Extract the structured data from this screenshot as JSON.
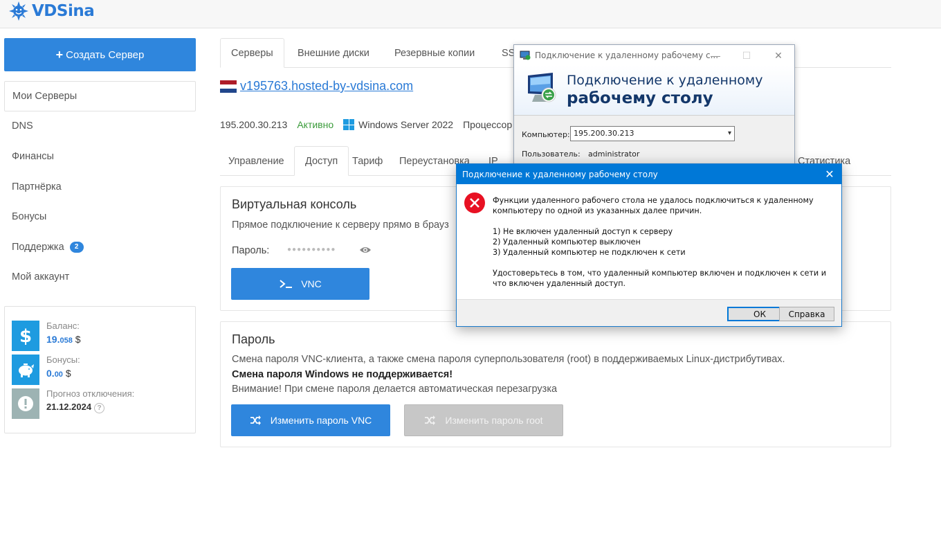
{
  "brand": {
    "logo_text": "VDSina"
  },
  "sidebar": {
    "create_label": "Создать Сервер",
    "items": [
      {
        "label": "Мои Серверы"
      },
      {
        "label": "DNS"
      },
      {
        "label": "Финансы"
      },
      {
        "label": "Партнёрка"
      },
      {
        "label": "Бонусы"
      },
      {
        "label": "Поддержка",
        "badge": "2"
      },
      {
        "label": "Мой аккаунт"
      }
    ],
    "balance": {
      "label": "Баланс:",
      "int": "19.",
      "dec": "058",
      "currency": "$"
    },
    "bonuses": {
      "label": "Бонусы:",
      "int": "0.",
      "dec": "00",
      "currency": "$"
    },
    "forecast": {
      "label": "Прогноз отключения:",
      "value": "21.12.2024",
      "help": "?"
    }
  },
  "main": {
    "tabs": [
      "Серверы",
      "Внешние диски",
      "Резервные копии",
      "SS"
    ],
    "host": "v195763.hosted-by-vdsina.com",
    "ip": "195.200.30.213",
    "status": "Активно",
    "os": "Windows Server 2022",
    "cpu_label": "Процессор",
    "sub_tabs": [
      "Управление",
      "Доступ",
      "Тариф",
      "Переустановка",
      "IP",
      "Статистика"
    ],
    "console": {
      "title": "Виртуальная консоль",
      "desc": "Прямое подключение к серверу прямо в брауз",
      "password_label": "Пароль:",
      "password_mask": "●●●●●●●●●●",
      "vnc_label": "VNC"
    },
    "password_panel": {
      "title": "Пароль",
      "line1": "Смена пароля VNC-клиента, а также смена пароля суперпользователя (root) в поддерживаемых Linux-дистрибутивах.",
      "line2": "Смена пароля Windows не поддерживается!",
      "line3": "Внимание! При смене пароля делается автоматическая перезагрузка",
      "btn_vnc": "Изменить пароль VNC",
      "btn_root": "Изменить пароль root"
    }
  },
  "rdp_window": {
    "title": "Подключение к удаленному рабочему с...",
    "heading1": "Подключение к удаленному",
    "heading2": "рабочему столу",
    "computer_label": "Компьютер:",
    "computer_value": "195.200.30.213",
    "user_label": "Пользователь:",
    "user_value": "administrator"
  },
  "error_dialog": {
    "title": "Подключение к удаленному рабочему столу",
    "intro": "Функции удаленного рабочего стола не удалось подключиться к удаленному компьютеру по одной из указанных далее причин.",
    "reason1": "1) Не включен удаленный доступ к серверу",
    "reason2": "2) Удаленный компьютер выключен",
    "reason3": "3) Удаленный компьютер не подключен к сети",
    "advice": "Удостоверьтесь в том, что удаленный компьютер включен и подключен к сети и что включен удаленный доступ.",
    "ok_label": "ОК",
    "help_label": "Справка"
  },
  "colors": {
    "accent": "#2f86dd",
    "status_active": "#3a9b3a",
    "win_titlebar": "#0078d7",
    "error_red": "#e81123"
  }
}
